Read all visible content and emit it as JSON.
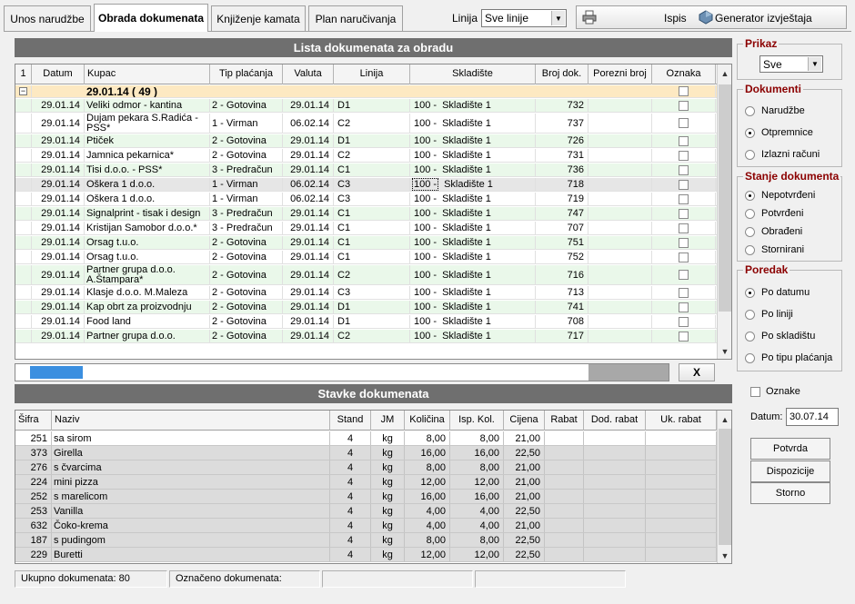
{
  "tabs": [
    {
      "label": "Unos narudžbe",
      "active": false
    },
    {
      "label": "Obrada dokumenata",
      "active": true
    },
    {
      "label": "Knjiženje kamata",
      "active": false
    },
    {
      "label": "Plan naručivanja",
      "active": false
    }
  ],
  "top": {
    "linija_label": "Linija",
    "linija_value": "Sve linije",
    "print_label": "Ispis",
    "generator_label": "Generator izvještaja"
  },
  "docs": {
    "title": "Lista dokumenata za obradu",
    "row_num_header": "1",
    "columns": [
      "Datum",
      "Kupac",
      "Tip plaćanja",
      "Valuta",
      "Linija",
      "Skladište",
      "Broj dok.",
      "Porezni broj",
      "Oznaka"
    ],
    "group_label": "29.01.14 ( 49 )",
    "rows": [
      {
        "datum": "29.01.14",
        "kupac": "Veliki odmor - kantina",
        "tip": "2 - Gotovina",
        "valuta": "29.01.14",
        "linija": "D1",
        "sk": "100 -",
        "skladiste": "Skladište 1",
        "broj": "732"
      },
      {
        "datum": "29.01.14",
        "kupac": "Dujam pekara S.Radića - PSS*",
        "tip": "1 - Virman",
        "valuta": "06.02.14",
        "linija": "C2",
        "sk": "100 -",
        "skladiste": "Skladište 1",
        "broj": "737"
      },
      {
        "datum": "29.01.14",
        "kupac": "Ptiček",
        "tip": "2 - Gotovina",
        "valuta": "29.01.14",
        "linija": "D1",
        "sk": "100 -",
        "skladiste": "Skladište 1",
        "broj": "726"
      },
      {
        "datum": "29.01.14",
        "kupac": "Jamnica pekarnica*",
        "tip": "2 - Gotovina",
        "valuta": "29.01.14",
        "linija": "C2",
        "sk": "100 -",
        "skladiste": "Skladište 1",
        "broj": "731"
      },
      {
        "datum": "29.01.14",
        "kupac": "Tisi d.o.o. - PSS*",
        "tip": "3 - Predračun",
        "valuta": "29.01.14",
        "linija": "C1",
        "sk": "100 -",
        "skladiste": "Skladište 1",
        "broj": "736"
      },
      {
        "datum": "29.01.14",
        "kupac": "Oškera 1 d.o.o.",
        "tip": "1 - Virman",
        "valuta": "06.02.14",
        "linija": "C3",
        "sk": "100 -",
        "skladiste": "Skladište 1",
        "broj": "718"
      },
      {
        "datum": "29.01.14",
        "kupac": "Oškera 1 d.o.o.",
        "tip": "1 - Virman",
        "valuta": "06.02.14",
        "linija": "C3",
        "sk": "100 -",
        "skladiste": "Skladište 1",
        "broj": "719"
      },
      {
        "datum": "29.01.14",
        "kupac": "Signalprint - tisak i design",
        "tip": "3 - Predračun",
        "valuta": "29.01.14",
        "linija": "C1",
        "sk": "100 -",
        "skladiste": "Skladište 1",
        "broj": "747"
      },
      {
        "datum": "29.01.14",
        "kupac": "Kristijan Samobor d.o.o.*",
        "tip": "3 - Predračun",
        "valuta": "29.01.14",
        "linija": "C1",
        "sk": "100 -",
        "skladiste": "Skladište 1",
        "broj": "707"
      },
      {
        "datum": "29.01.14",
        "kupac": "Orsag t.u.o.",
        "tip": "2 - Gotovina",
        "valuta": "29.01.14",
        "linija": "C1",
        "sk": "100 -",
        "skladiste": "Skladište 1",
        "broj": "751"
      },
      {
        "datum": "29.01.14",
        "kupac": "Orsag t.u.o.",
        "tip": "2 - Gotovina",
        "valuta": "29.01.14",
        "linija": "C1",
        "sk": "100 -",
        "skladiste": "Skladište 1",
        "broj": "752"
      },
      {
        "datum": "29.01.14",
        "kupac": "Partner grupa d.o.o. A.Štampara*",
        "tip": "2 - Gotovina",
        "valuta": "29.01.14",
        "linija": "C2",
        "sk": "100 -",
        "skladiste": "Skladište 1",
        "broj": "716"
      },
      {
        "datum": "29.01.14",
        "kupac": "Klasje d.o.o. M.Maleza",
        "tip": "2 - Gotovina",
        "valuta": "29.01.14",
        "linija": "C3",
        "sk": "100 -",
        "skladiste": "Skladište 1",
        "broj": "713"
      },
      {
        "datum": "29.01.14",
        "kupac": "Kap obrt za proizvodnju",
        "tip": "2 - Gotovina",
        "valuta": "29.01.14",
        "linija": "D1",
        "sk": "100 -",
        "skladiste": "Skladište 1",
        "broj": "741"
      },
      {
        "datum": "29.01.14",
        "kupac": "Food land",
        "tip": "2 - Gotovina",
        "valuta": "29.01.14",
        "linija": "D1",
        "sk": "100 -",
        "skladiste": "Skladište 1",
        "broj": "708"
      },
      {
        "datum": "29.01.14",
        "kupac": "Partner grupa d.o.o.",
        "tip": "2 - Gotovina",
        "valuta": "29.01.14",
        "linija": "C2",
        "sk": "100 -",
        "skladiste": "Skladište 1",
        "broj": "717"
      }
    ],
    "close_label": "X"
  },
  "items": {
    "title": "Stavke dokumenata",
    "columns": [
      "Šifra",
      "Naziv",
      "Stand",
      "JM",
      "Količina",
      "Isp. Kol.",
      "Cijena",
      "Rabat",
      "Dod. rabat",
      "Uk. rabat"
    ],
    "rows": [
      {
        "sifra": "251",
        "naziv": "sa sirom",
        "stand": "4",
        "jm": "kg",
        "kol": "8,00",
        "isp": "8,00",
        "cijena": "21,00"
      },
      {
        "sifra": "373",
        "naziv": "Girella",
        "stand": "4",
        "jm": "kg",
        "kol": "16,00",
        "isp": "16,00",
        "cijena": "22,50"
      },
      {
        "sifra": "276",
        "naziv": "s čvarcima",
        "stand": "4",
        "jm": "kg",
        "kol": "8,00",
        "isp": "8,00",
        "cijena": "21,00"
      },
      {
        "sifra": "224",
        "naziv": "mini pizza",
        "stand": "4",
        "jm": "kg",
        "kol": "12,00",
        "isp": "12,00",
        "cijena": "21,00"
      },
      {
        "sifra": "252",
        "naziv": "s marelicom",
        "stand": "4",
        "jm": "kg",
        "kol": "16,00",
        "isp": "16,00",
        "cijena": "21,00"
      },
      {
        "sifra": "253",
        "naziv": "Vanilla",
        "stand": "4",
        "jm": "kg",
        "kol": "4,00",
        "isp": "4,00",
        "cijena": "22,50"
      },
      {
        "sifra": "632",
        "naziv": "Čoko-krema",
        "stand": "4",
        "jm": "kg",
        "kol": "4,00",
        "isp": "4,00",
        "cijena": "21,00"
      },
      {
        "sifra": "187",
        "naziv": "s pudingom",
        "stand": "4",
        "jm": "kg",
        "kol": "8,00",
        "isp": "8,00",
        "cijena": "22,50"
      },
      {
        "sifra": "229",
        "naziv": "Buretti",
        "stand": "4",
        "jm": "kg",
        "kol": "12,00",
        "isp": "12,00",
        "cijena": "22,50"
      }
    ]
  },
  "side": {
    "prikaz_title": "Prikaz",
    "prikaz_value": "Sve",
    "dokumenti_title": "Dokumenti",
    "dokumenti": [
      "Narudžbe",
      "Otpremnice",
      "Izlazni računi"
    ],
    "dokumenti_selected": 1,
    "stanje_title": "Stanje dokumenta",
    "stanje": [
      "Nepotvrđeni",
      "Potvrđeni",
      "Obrađeni",
      "Stornirani"
    ],
    "stanje_selected": 0,
    "poredak_title": "Poredak",
    "poredak": [
      "Po datumu",
      "Po liniji",
      "Po skladištu",
      "Po tipu plaćanja"
    ],
    "poredak_selected": 0,
    "oznake_label": "Oznake",
    "datum_label": "Datum:",
    "datum_value": "30.07.14",
    "buttons": [
      "Potvrda",
      "Dispozicije",
      "Storno"
    ]
  },
  "status": {
    "ukupno": "Ukupno dokumenata: 80",
    "oznaceno": "Označeno dokumenata:"
  }
}
